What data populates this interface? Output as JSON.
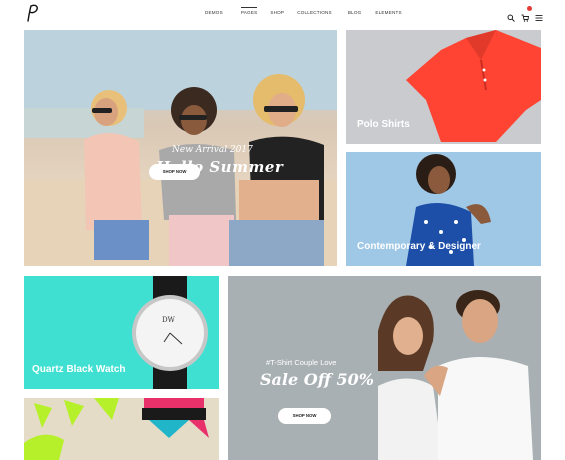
{
  "header": {
    "logo_letter": "p",
    "nav": [
      {
        "label": "DEMOS",
        "active": false
      },
      {
        "label": "PAGES",
        "active": true
      },
      {
        "label": "SHOP",
        "active": false
      },
      {
        "label": "COLLECTIONS",
        "active": false
      },
      {
        "label": "BLOG",
        "active": false
      },
      {
        "label": "ELEMENTS",
        "active": false
      }
    ],
    "icons": [
      "search-icon",
      "cart-icon",
      "menu-icon"
    ]
  },
  "hero": {
    "subtitle": "New Arrival 2017",
    "title": "Hello Summer",
    "button": "SHOP NOW"
  },
  "tiles": {
    "polo": {
      "label": "Polo Shirts",
      "accent": "#ff4433"
    },
    "contemporary": {
      "label": "Contemporary & Designer"
    },
    "quartz": {
      "label": "Quartz Black Watch",
      "watch_brand": "DW"
    },
    "tshirt": {
      "subtitle": "#T-Shirt Couple Love",
      "title": "Sale Off 50%",
      "button": "SHOP NOW"
    }
  },
  "colors": {
    "turquoise": "#3fe0d2",
    "badge": "#e53935"
  }
}
